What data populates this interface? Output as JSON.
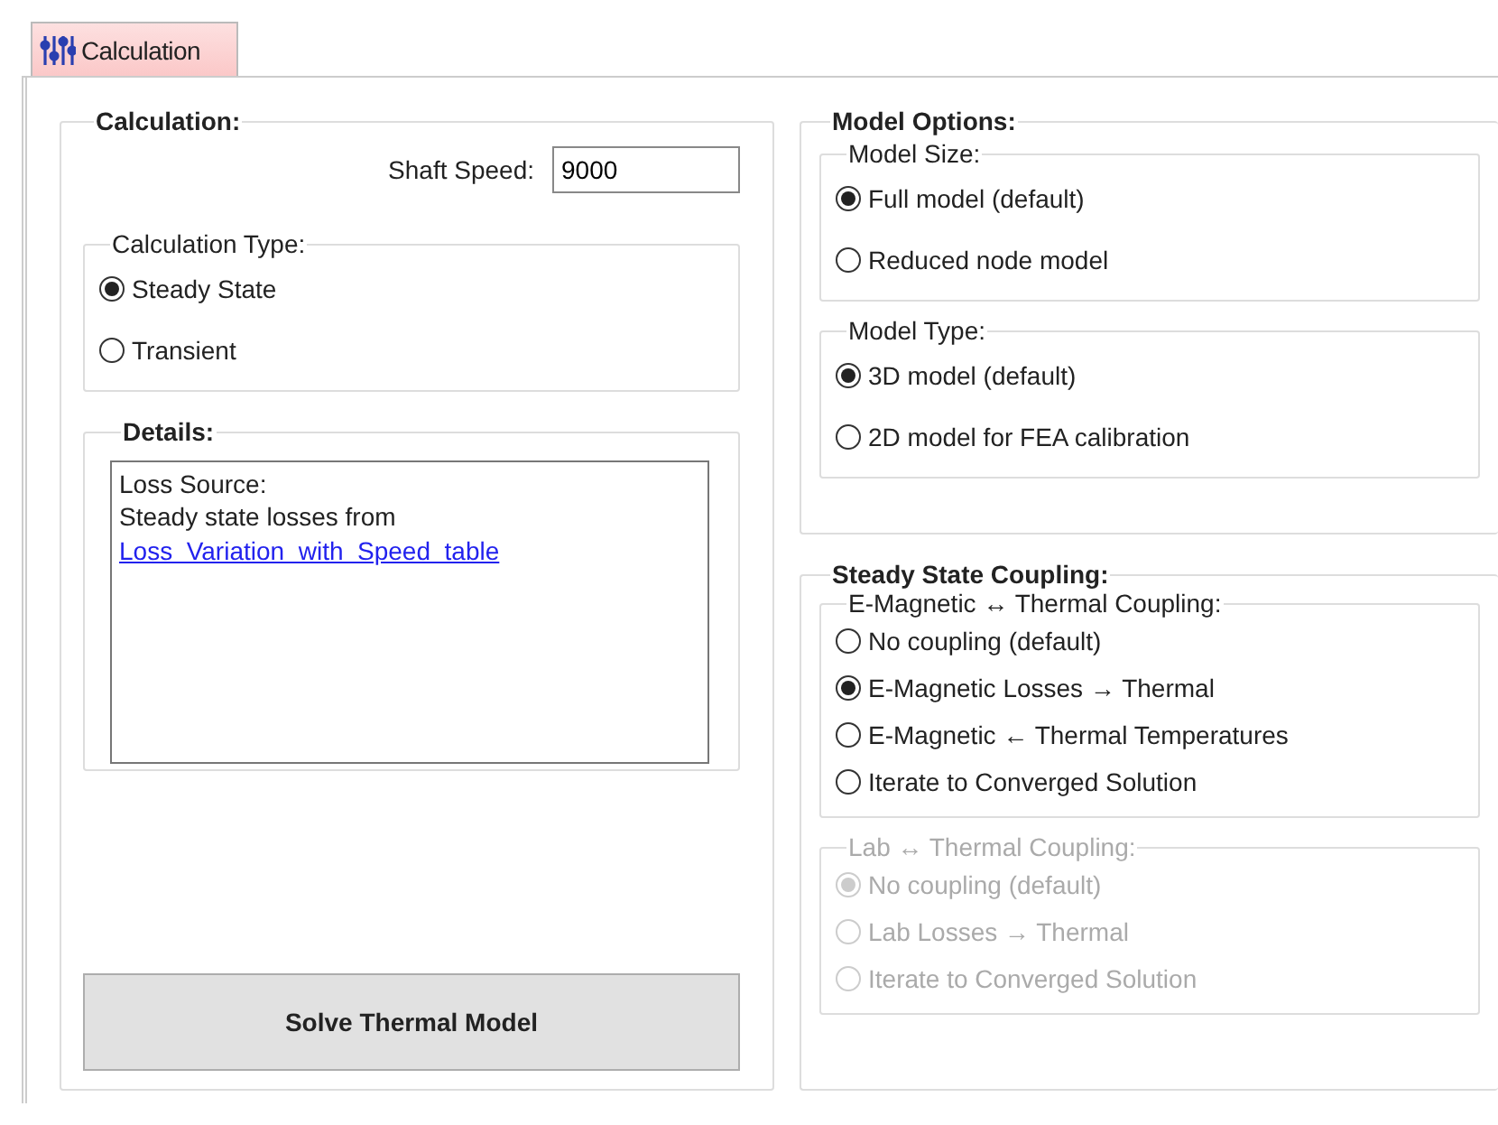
{
  "tabs": [
    {
      "label": "Calculation",
      "selected": true
    }
  ],
  "calculation": {
    "title": "Calculation:",
    "shaft_speed": {
      "label": "Shaft Speed:",
      "value": "9000"
    },
    "calculation_type": {
      "title": "Calculation Type:",
      "options": [
        {
          "label": "Steady State",
          "selected": true
        },
        {
          "label": "Transient",
          "selected": false
        }
      ]
    },
    "details": {
      "title": "Details:",
      "lines": [
        "Loss Source:",
        "Steady state losses from"
      ],
      "link": "Loss  Variation  with  Speed  table"
    },
    "solve_button": "Solve Thermal Model"
  },
  "model_options": {
    "title": "Model Options:",
    "groups": [
      {
        "title": "Model Size:",
        "options": [
          {
            "label": "Full model (default)",
            "selected": true
          },
          {
            "label": "Reduced node model",
            "selected": false
          }
        ]
      },
      {
        "title": "Model Type:",
        "options": [
          {
            "label": "3D model (default)",
            "selected": true
          },
          {
            "label": "2D model for FEA calibration",
            "selected": false
          }
        ]
      }
    ]
  },
  "coupling": {
    "title": "Steady State Coupling:",
    "groups": [
      {
        "title": "E-Magnetic ↔ Thermal Coupling:",
        "disabled": false,
        "options": [
          {
            "label": "No coupling (default)",
            "selected": false
          },
          {
            "label": "E-Magnetic Losses → Thermal",
            "selected": true
          },
          {
            "label": "E-Magnetic  ← Thermal Temperatures",
            "selected": false
          },
          {
            "label": "Iterate to Converged Solution",
            "selected": false
          }
        ]
      },
      {
        "title": "Lab ↔ Thermal Coupling:",
        "disabled": true,
        "options": [
          {
            "label": "No coupling (default)",
            "selected": true
          },
          {
            "label": "Lab Losses → Thermal",
            "selected": false
          },
          {
            "label": "Iterate to Converged Solution",
            "selected": false
          }
        ]
      }
    ]
  }
}
